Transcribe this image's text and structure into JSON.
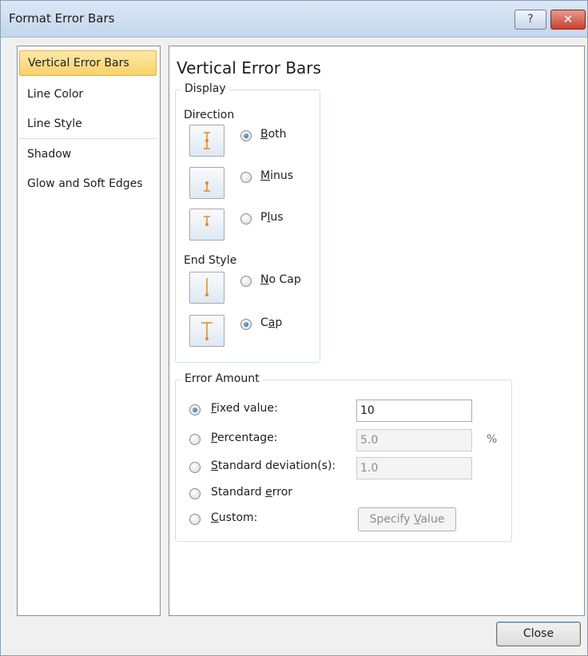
{
  "window": {
    "title": "Format Error Bars",
    "help_glyph": "?",
    "close_glyph": "✕"
  },
  "nav": {
    "items": [
      {
        "label": "Vertical Error Bars",
        "selected": true
      },
      {
        "label": "Line Color"
      },
      {
        "label": "Line Style"
      },
      {
        "label": "Shadow"
      },
      {
        "label": "Glow and Soft Edges"
      }
    ]
  },
  "panel": {
    "title": "Vertical Error Bars",
    "display": {
      "label": "Display",
      "direction_label": "Direction",
      "direction_options": [
        {
          "label_pre": "",
          "label_key": "B",
          "label_post": "oth",
          "checked": true,
          "icon": "both-bar-icon"
        },
        {
          "label_pre": "",
          "label_key": "M",
          "label_post": "inus",
          "checked": false,
          "icon": "minus-bar-icon"
        },
        {
          "label_pre": "P",
          "label_key": "l",
          "label_post": "us",
          "checked": false,
          "icon": "plus-bar-icon"
        }
      ],
      "end_style_label": "End Style",
      "end_style_options": [
        {
          "label_pre": "",
          "label_key": "N",
          "label_post": "o Cap",
          "checked": false,
          "icon": "no-cap-icon"
        },
        {
          "label_pre": "C",
          "label_key": "a",
          "label_post": "p",
          "checked": true,
          "icon": "cap-icon"
        }
      ]
    },
    "error_amount": {
      "label": "Error Amount",
      "fixed": {
        "label_pre": "",
        "label_key": "F",
        "label_post": "ixed value:",
        "value": "10",
        "checked": true
      },
      "percentage": {
        "label_pre": "",
        "label_key": "P",
        "label_post": "ercentage:",
        "value": "5.0",
        "unit": "%",
        "checked": false
      },
      "stddev": {
        "label_pre": "",
        "label_key": "S",
        "label_post": "tandard deviation(s):",
        "value": "1.0",
        "checked": false
      },
      "stderr": {
        "label_pre": "Standard ",
        "label_key": "e",
        "label_post": "rror",
        "checked": false
      },
      "custom": {
        "label_pre": "",
        "label_key": "C",
        "label_post": "ustom:",
        "checked": false
      },
      "specify_pre": "Specify ",
      "specify_key": "V",
      "specify_post": "alue"
    }
  },
  "footer": {
    "close_label": "Close"
  },
  "colors": {
    "accent_orange": "#e08a2b",
    "selection": "#f8d16a",
    "radio_blue": "#1b5fa8"
  }
}
